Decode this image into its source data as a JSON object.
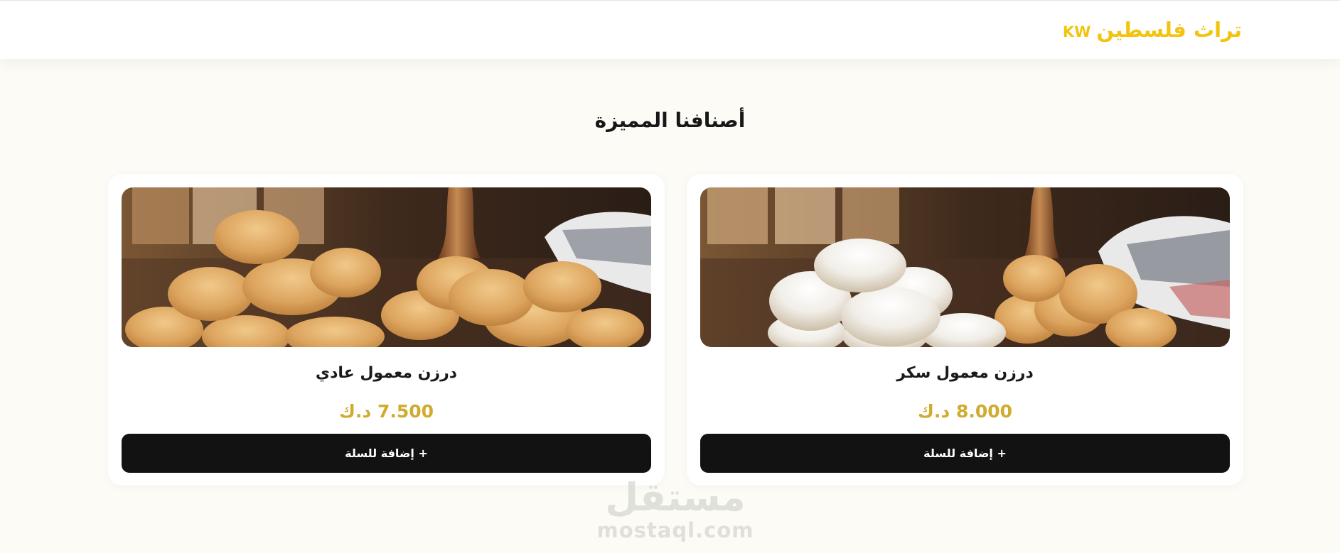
{
  "header": {
    "brand_name": "تراث فلسطين",
    "brand_suffix": "KW",
    "brand_color": "#f2c40f"
  },
  "section": {
    "title": "أصنافنا المميزة"
  },
  "products": [
    {
      "name": "درزن معمول سكر",
      "price": "8.000 د.ك",
      "button_label": "+ إضافة للسلة",
      "image": "maamoul-with-powdered-sugar"
    },
    {
      "name": "درزن معمول عادي",
      "price": "7.500 د.ك",
      "button_label": "+ إضافة للسلة",
      "image": "plain-maamoul"
    }
  ],
  "watermark": {
    "arabic": "مستقل",
    "latin": "mostaql.com"
  },
  "colors": {
    "price": "#cfab2e",
    "button_bg": "#121212",
    "page_bg": "#fcfbf6"
  }
}
